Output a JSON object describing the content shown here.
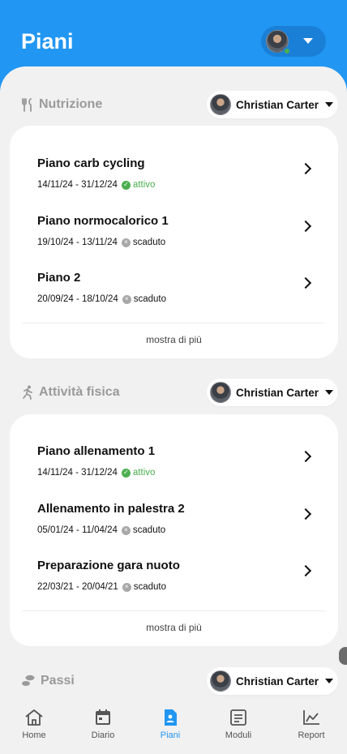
{
  "header": {
    "title": "Piani"
  },
  "colors": {
    "brand": "#2196f3",
    "active": "#4caf50",
    "expired": "#a8a8a8"
  },
  "sections": {
    "nutrition": {
      "title": "Nutrizione",
      "icon": "fork-knife-icon",
      "person": "Christian Carter",
      "plans": [
        {
          "name": "Piano carb cycling",
          "dates": "14/11/24 - 31/12/24",
          "status": "attivo"
        },
        {
          "name": "Piano normocalorico 1",
          "dates": "19/10/24 - 13/11/24",
          "status": "scaduto"
        },
        {
          "name": "Piano 2",
          "dates": "20/09/24 - 18/10/24",
          "status": "scaduto"
        }
      ],
      "show_more": "mostra di più"
    },
    "activity": {
      "title": "Attività fisica",
      "icon": "running-icon",
      "person": "Christian Carter",
      "plans": [
        {
          "name": "Piano allenamento 1",
          "dates": "14/11/24 - 31/12/24",
          "status": "attivo"
        },
        {
          "name": "Allenamento in palestra 2",
          "dates": "05/01/24 - 11/04/24",
          "status": "scaduto"
        },
        {
          "name": "Preparazione gara nuoto",
          "dates": "22/03/21 - 20/04/21",
          "status": "scaduto"
        }
      ],
      "show_more": "mostra di più"
    },
    "steps": {
      "title": "Passi",
      "icon": "footsteps-icon",
      "person": "Christian Carter"
    }
  },
  "tabs": [
    {
      "label": "Home",
      "icon": "home-icon"
    },
    {
      "label": "Diario",
      "icon": "calendar-icon"
    },
    {
      "label": "Piani",
      "icon": "document-icon",
      "active": true
    },
    {
      "label": "Moduli",
      "icon": "form-icon"
    },
    {
      "label": "Report",
      "icon": "chart-icon"
    }
  ]
}
